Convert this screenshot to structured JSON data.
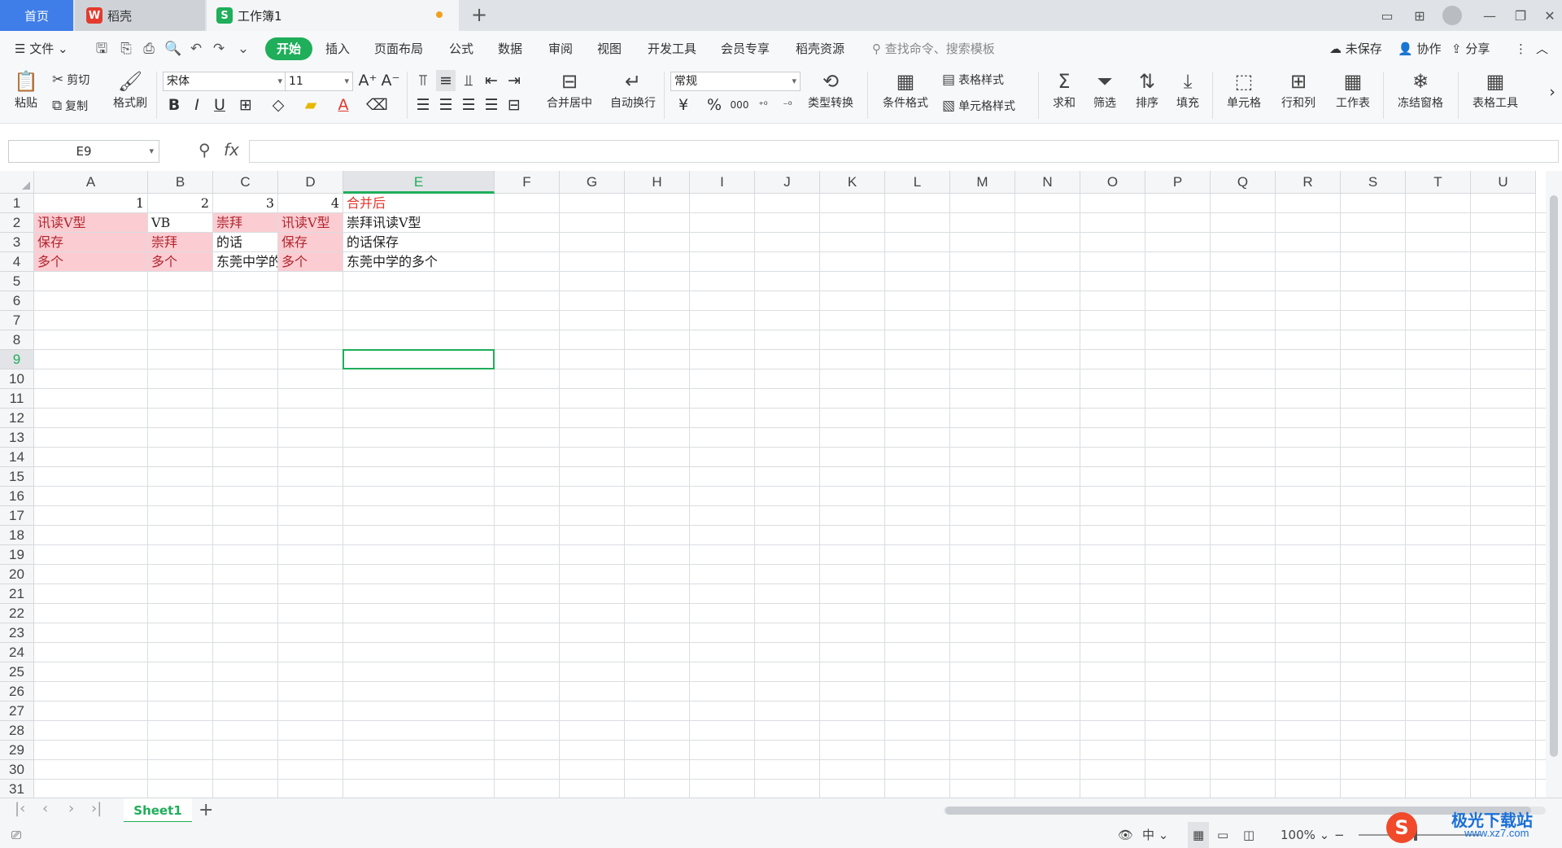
{
  "tabs": {
    "home": "首页",
    "docer": "稻壳",
    "workbook": "工作簿1",
    "docer_logo": "W",
    "workbook_logo": "S"
  },
  "menu": {
    "file": "文件",
    "items": [
      "开始",
      "插入",
      "页面布局",
      "公式",
      "数据",
      "审阅",
      "视图",
      "开发工具",
      "会员专享",
      "稻壳资源"
    ],
    "search_placeholder": "查找命令、搜索模板",
    "unsaved": "未保存",
    "collab": "协作",
    "share": "分享"
  },
  "ribbon": {
    "paste": "粘贴",
    "cut": "剪切",
    "copy": "复制",
    "format_painter": "格式刷",
    "font_name": "宋体",
    "font_size": "11",
    "merge_center": "合并居中",
    "auto_wrap": "自动换行",
    "number_format": "常规",
    "currency_symbol": "¥",
    "percent_symbol": "%",
    "thousands": "000",
    "type_convert": "类型转换",
    "conditional_format": "条件格式",
    "table_style": "表格样式",
    "cell_style": "单元格样式",
    "sum": "求和",
    "filter": "筛选",
    "sort": "排序",
    "fill": "填充",
    "cell": "单元格",
    "row_col": "行和列",
    "worksheet": "工作表",
    "freeze": "冻结窗格",
    "table_tools": "表格工具"
  },
  "formula_bar": {
    "name_box": "E9",
    "fx": "fx",
    "content": ""
  },
  "grid": {
    "columns": [
      "A",
      "B",
      "C",
      "D",
      "E",
      "F",
      "G",
      "H",
      "I",
      "J",
      "K",
      "L",
      "M",
      "N",
      "O",
      "P",
      "Q",
      "R",
      "S",
      "T",
      "U"
    ],
    "selected_column": "E",
    "selected_row": 9,
    "row_count": 31,
    "cells": {
      "A1": "1",
      "B1": "2",
      "C1": "3",
      "D1": "4",
      "E1": "合并后",
      "A2": "讯读V型",
      "B2": "VB",
      "C2": "崇拜",
      "D2": "讯读V型",
      "E2": "崇拜讯读V型",
      "A3": "保存",
      "B3": "崇拜",
      "C3": "的话",
      "D3": "保存",
      "E3": "的话保存",
      "A4": "多个",
      "B4": "多个",
      "C4": "东莞中学的",
      "D4": "多个",
      "E4": "东莞中学的多个"
    },
    "highlight_color": "#fbcdd2",
    "highlight_text_color": "#b0252f",
    "accent_color": "#1fae5a"
  },
  "sheets": {
    "active": "Sheet1",
    "add": "+"
  },
  "status": {
    "zoom": "100%",
    "ime": "中"
  },
  "watermark": {
    "text": "极光下载站",
    "url": "www.xz7.com"
  }
}
